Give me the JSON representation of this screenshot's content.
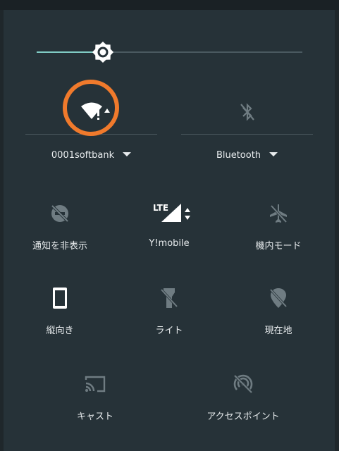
{
  "brightness": {
    "level": 0.25
  },
  "wifi": {
    "label": "0001softbank",
    "icon": "wifi-warning-icon"
  },
  "bluetooth": {
    "label": "Bluetooth",
    "icon": "bluetooth-disabled-icon"
  },
  "tiles": {
    "dnd": {
      "label": "通知を非表示",
      "icon": "do-not-disturb-off-icon"
    },
    "mobile": {
      "label": "Y!mobile",
      "network": "LTE",
      "icon": "signal-icon"
    },
    "airplane": {
      "label": "機内モード",
      "icon": "airplane-icon"
    },
    "rotation": {
      "label": "縦向き",
      "icon": "portrait-phone-icon"
    },
    "flashlight": {
      "label": "ライト",
      "icon": "flashlight-off-icon"
    },
    "location": {
      "label": "現在地",
      "icon": "location-off-icon"
    },
    "cast": {
      "label": "キャスト",
      "icon": "cast-icon"
    },
    "hotspot": {
      "label": "アクセスポイント",
      "icon": "hotspot-off-icon"
    }
  },
  "colors": {
    "accent": "#80cbc4",
    "highlight": "#f07a2c",
    "background": "#263238"
  }
}
